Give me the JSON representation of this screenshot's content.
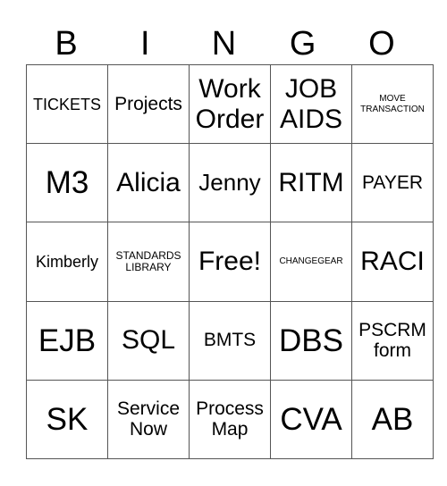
{
  "header": {
    "letters": [
      "B",
      "I",
      "N",
      "G",
      "O"
    ]
  },
  "cells": [
    [
      "TICKETS",
      "Projects",
      "Work Order",
      "JOB AIDS",
      "MOVE TRANSACTION"
    ],
    [
      "M3",
      "Alicia",
      "Jenny",
      "RITM",
      "PAYER"
    ],
    [
      "Kimberly",
      "STANDARDS LIBRARY",
      "Free!",
      "CHANGEGEAR",
      "RACI"
    ],
    [
      "EJB",
      "SQL",
      "BMTS",
      "DBS",
      "PSCRM form"
    ],
    [
      "SK",
      "Service Now",
      "Process Map",
      "CVA",
      "AB"
    ]
  ]
}
